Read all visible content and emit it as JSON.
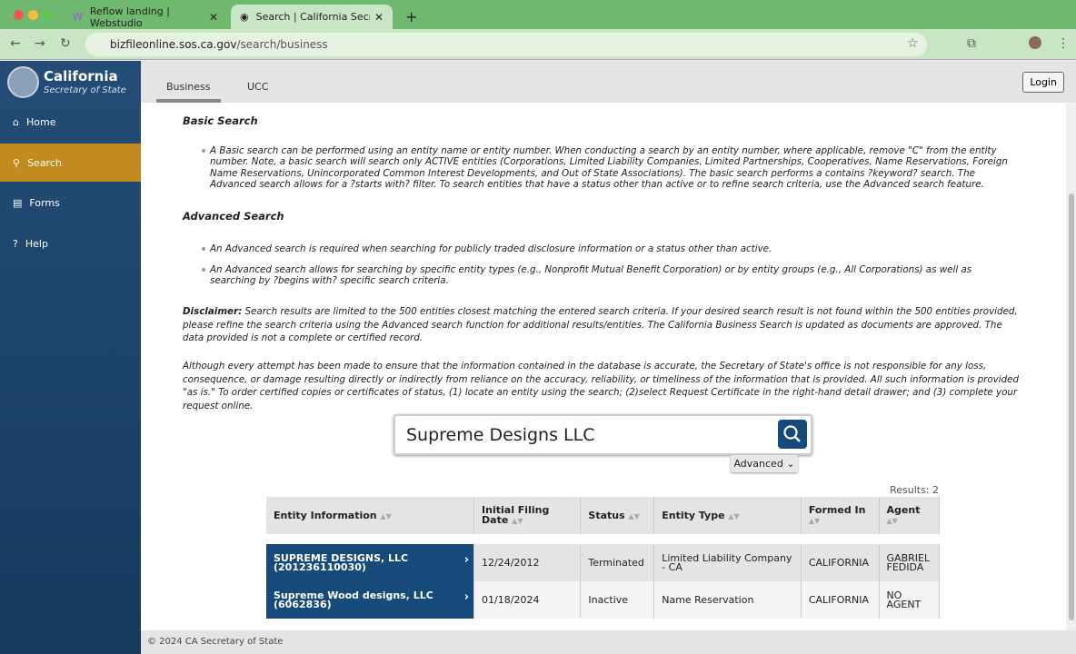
{
  "browser": {
    "tabs": [
      {
        "label": "Reflow landing | Webstudio"
      },
      {
        "label": "Search | California Secretary o"
      }
    ],
    "url_host": "bizfileonline.sos.ca.gov",
    "url_path": "/search/business"
  },
  "sidebar": {
    "brand_title": "California",
    "brand_subtitle": "Secretary of State",
    "items": [
      {
        "label": "Home",
        "icon": "home-icon"
      },
      {
        "label": "Search",
        "icon": "search-icon",
        "active": true
      },
      {
        "label": "Forms",
        "icon": "forms-icon"
      },
      {
        "label": "Help",
        "icon": "help-icon"
      }
    ]
  },
  "header": {
    "tabs": [
      {
        "label": "Business"
      },
      {
        "label": "UCC"
      }
    ],
    "login": "Login"
  },
  "content": {
    "basic_title": "Basic Search",
    "basic_text": "A Basic search can be performed using an entity name or entity number. When conducting a search by an entity number, where applicable, remove \"C\" from the entity number. Note, a basic search will search only ACTIVE entities (Corporations, Limited Liability Companies, Limited Partnerships, Cooperatives, Name Reservations, Foreign Name Reservations, Unincorporated Common Interest Developments, and Out of State Associations). The basic search performs a contains ?keyword? search. The Advanced search allows for a ?starts with? filter. To search entities that have a status other than active or to refine search criteria, use the Advanced search feature.",
    "advanced_title": "Advanced Search",
    "advanced_items": [
      "An Advanced search is required when searching for publicly traded disclosure information or a status other than active.",
      "An Advanced search allows for searching by specific entity types (e.g., Nonprofit Mutual Benefit Corporation) or by entity groups (e.g., All Corporations) as well as searching by ?begins with? specific search criteria."
    ],
    "disclaimer_label": "Disclaimer:",
    "disclaimer": " Search results are limited to the 500 entities closest matching the entered search criteria. If your desired search result is not found within the 500 entities provided, please refine the search criteria using the Advanced search function for additional results/entities. The California Business Search is updated as documents are approved. The data provided is not a complete or certified record.",
    "notice": "Although every attempt has been made to ensure that the information contained in the database is accurate, the Secretary of State's office is not responsible for any loss, consequence, or damage resulting directly or indirectly from reliance on the accuracy, reliability, or timeliness of the information that is provided. All such information is provided \"as is.\" To order certified copies or certificates of status, (1) locate an entity using the search; (2)select Request Certificate in the right-hand detail drawer; and (3) complete your request online."
  },
  "search": {
    "value": "Supreme Designs LLC",
    "advanced": "Advanced"
  },
  "results": {
    "count_label": "Results: 2",
    "columns": [
      "Entity Information",
      "Initial Filing Date",
      "Status",
      "Entity Type",
      "Formed In",
      "Agent"
    ],
    "rows": [
      {
        "entity": "SUPREME DESIGNS, LLC (201236110030)",
        "date": "12/24/2012",
        "status": "Terminated",
        "type": "Limited Liability Company - CA",
        "formed": "CALIFORNIA",
        "agent": "GABRIEL FEDIDA"
      },
      {
        "entity": "Supreme Wood designs, LLC (6062836)",
        "date": "01/18/2024",
        "status": "Inactive",
        "type": "Name Reservation",
        "formed": "CALIFORNIA",
        "agent": "NO AGENT"
      }
    ]
  },
  "footer": "© 2024 CA Secretary of State",
  "colors": {
    "sidebar": "#1e4770",
    "active_nav": "#c28a1f",
    "entity_cell": "#164a7a",
    "browser": "#6fb86f"
  }
}
